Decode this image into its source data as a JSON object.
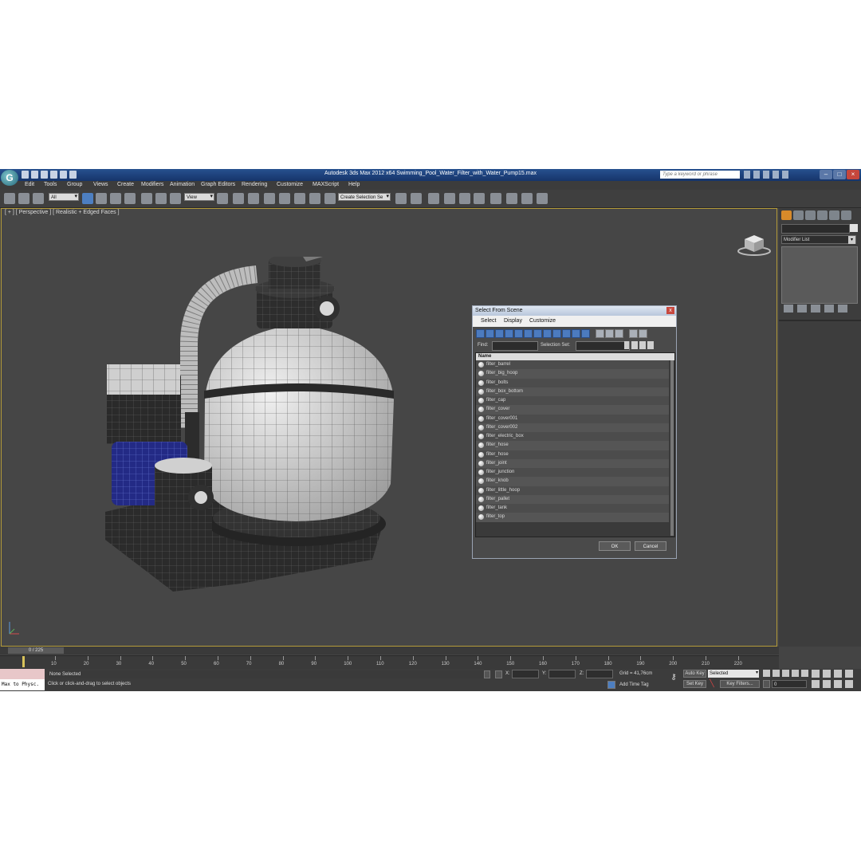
{
  "titlebar": {
    "logo": "G",
    "title": "Autodesk 3ds Max  2012 x64      Swimming_Pool_Water_Filter_with_Water_Pump15.max",
    "search_placeholder": "Type a keyword or phrase"
  },
  "menu": [
    "Edit",
    "Tools",
    "Group",
    "Views",
    "Create",
    "Modifiers",
    "Animation",
    "Graph Editors",
    "Rendering",
    "Customize",
    "MAXScript",
    "Help"
  ],
  "toolbar": {
    "selection_filter": "All",
    "ref_coord": "View",
    "named_selection": "Create Selection Se"
  },
  "viewport": {
    "label": "[ + ] [ Perspective ] [ Realistic + Edged Faces ]"
  },
  "command_panel": {
    "modifier_list": "Modifier List"
  },
  "dialog": {
    "title": "Select From Scene",
    "close": "x",
    "menu": [
      "Select",
      "Display",
      "Customize"
    ],
    "find_label": "Find:",
    "selection_set_label": "Selection Set:",
    "column_name": "Name",
    "items": [
      "filter_barrel",
      "filter_big_hoop",
      "filter_bolts",
      "filter_box_bottom",
      "filter_cap",
      "filter_cover",
      "filter_cover001",
      "filter_cover002",
      "filter_electric_box",
      "filter_hose",
      "filter_hose",
      "filter_joint",
      "filter_junction",
      "filter_knob",
      "filter_little_hoop",
      "filter_pallet",
      "filter_tank",
      "filter_top"
    ],
    "ok": "OK",
    "cancel": "Cancel"
  },
  "timeline": {
    "frame_display": "0 / 225",
    "ticks": [
      "10",
      "20",
      "30",
      "40",
      "50",
      "60",
      "70",
      "80",
      "90",
      "100",
      "110",
      "120",
      "130",
      "140",
      "150",
      "160",
      "170",
      "180",
      "190",
      "200",
      "210",
      "220"
    ]
  },
  "status": {
    "maxscript": "Max to Physc.",
    "selection": "None Selected",
    "prompt": "Click or click-and-drag to select objects",
    "x_label": "X:",
    "y_label": "Y:",
    "z_label": "Z:",
    "grid": "Grid = 41,76cm",
    "add_time_tag": "Add Time Tag",
    "auto_key": "Auto Key",
    "set_key": "Set Key",
    "key_mode": "Selected",
    "key_filters": "Key Filters...",
    "current_frame": "0"
  }
}
